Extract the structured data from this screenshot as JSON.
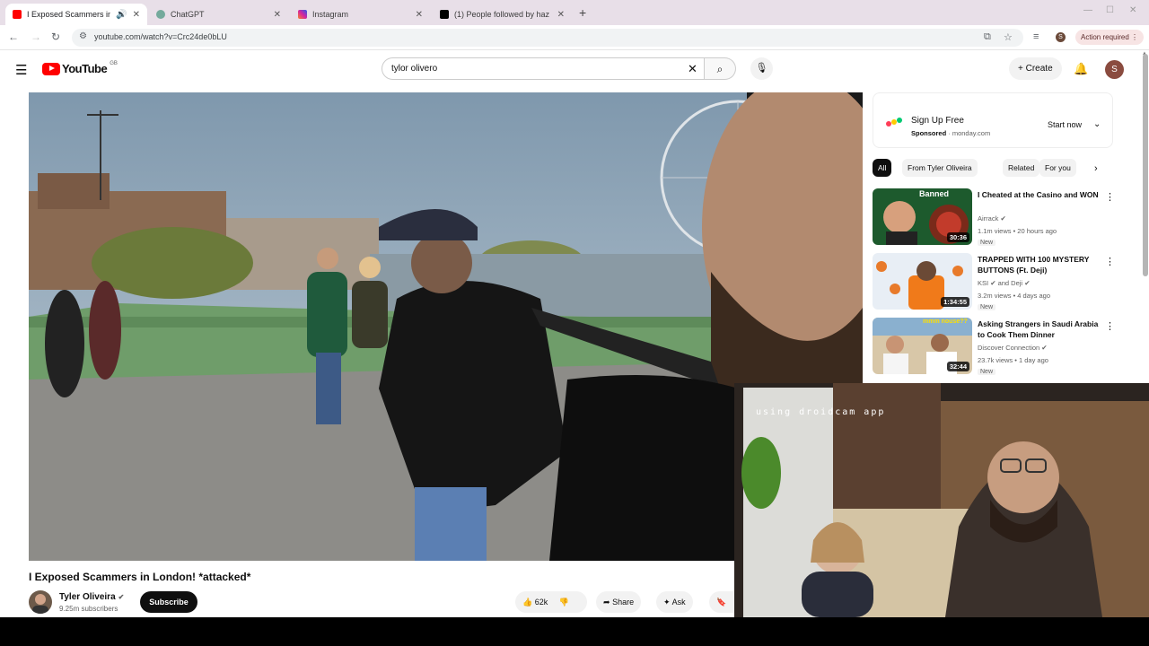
{
  "browser": {
    "tabs": [
      {
        "title": "I Exposed Scammers in Lon",
        "active": true,
        "favicon_color": "#ff0000"
      },
      {
        "title": "ChatGPT",
        "active": false,
        "favicon_color": "#74aa9c"
      },
      {
        "title": "Instagram",
        "active": false,
        "favicon_color": "#d6249f"
      },
      {
        "title": "(1) People followed by haz",
        "active": false,
        "favicon_color": "#000000"
      }
    ],
    "url": "youtube.com/watch?v=Crc24de0bLU",
    "action_required": "Action required",
    "profile_initial": "S"
  },
  "header": {
    "logo_text": "YouTube",
    "country_code": "GB",
    "search_query": "tylor olivero",
    "create_label": "Create",
    "avatar_initial": "S"
  },
  "video": {
    "title": "I Exposed Scammers in London! *attacked*",
    "channel": "Tyler Oliveira",
    "subscribers": "9.25m subscribers",
    "subscribe_label": "Subscribe",
    "likes": "62k",
    "share_label": "Share",
    "ask_label": "Ask"
  },
  "sidebar": {
    "ad": {
      "headline": "Sign Up Free",
      "sponsored": "Sponsored",
      "domain": "monday.com",
      "cta": "Start now"
    },
    "chips": [
      "All",
      "From Tyler Oliveira",
      "Related",
      "For you"
    ],
    "videos": [
      {
        "title": "I Cheated at the Casino and WON",
        "channel": "Airrack",
        "meta": "1.1m views • 20 hours ago",
        "badge": "New",
        "duration": "30:36",
        "thumb_text": "Banned"
      },
      {
        "title": "TRAPPED WITH 100 MYSTERY BUTTONS (Ft. Deji)",
        "channel": "KSI",
        "channel_extra": "and Deji",
        "meta": "3.2m views • 4 days ago",
        "badge": "New",
        "duration": "1:34:55"
      },
      {
        "title": "Asking Strangers in Saudi Arabia to Cook Them Dinner",
        "channel": "Discover Connection",
        "meta": "23.7k views • 1 day ago",
        "badge": "New",
        "duration": "32:44",
        "thumb_text": "mmm nouse??"
      }
    ]
  },
  "webcam": {
    "overlay_text": "using droidcam app"
  }
}
